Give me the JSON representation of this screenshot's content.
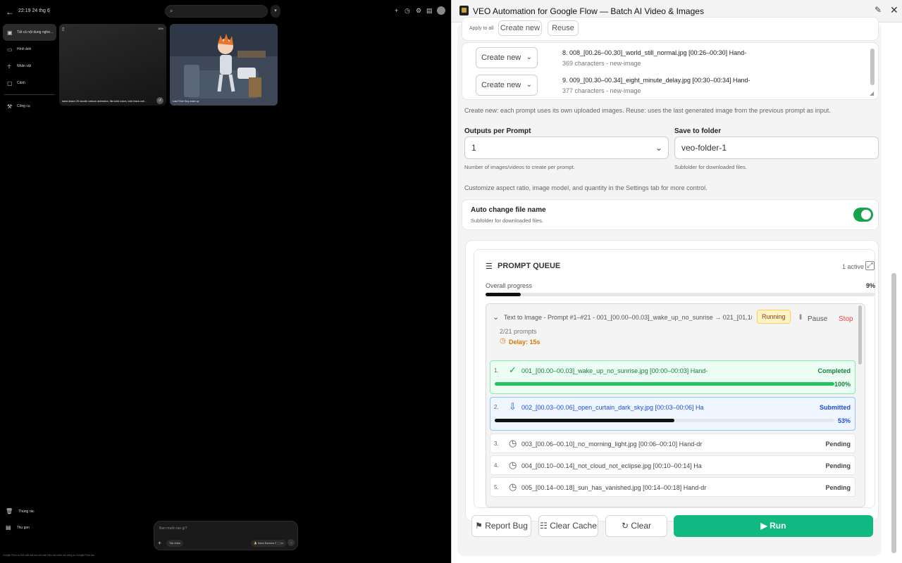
{
  "left": {
    "title": "22:19 24 thg 6",
    "sidebar": [
      {
        "icon": "image-icon",
        "label": "Tất cả nội dung nghe...",
        "active": true
      },
      {
        "icon": "photo-icon",
        "label": "Hình ảnh"
      },
      {
        "icon": "person-icon",
        "label": "Nhân vật"
      },
      {
        "icon": "scene-icon",
        "label": "Cảnh"
      },
      {
        "icon": "tools-icon",
        "label": "Công cụ"
      }
    ],
    "thumbnails": [
      {
        "caption": "hand drawn 2D doodle cartoon animation, flat solid colors, bold black outl...",
        "badge": "16%"
      },
      {
        "caption": "Last Time Guy wake up"
      }
    ],
    "bottom_items": [
      {
        "icon": "trash-icon",
        "label": "Thùng rác"
      },
      {
        "icon": "collapse-icon",
        "label": "Thu gọn"
      }
    ],
    "compose": {
      "placeholder": "Bạn muốn tạo gì?",
      "chip_left": "Tác nhân",
      "chip_right": "🍌 Nano Banana 2 ⬚ 1x"
    },
    "footer": "Google Flow có thể mắc sai sót nên bạn hãy xác minh nội dung do Google Flow tạo"
  },
  "header": {
    "title": "VEO Automation for Google Flow — Batch AI Video & Images"
  },
  "apply_all": {
    "label": "Apply to all",
    "create_new": "Create new",
    "reuse": "Reuse"
  },
  "prompt_items": [
    {
      "mode": "Create new",
      "line1": "8. 008_[00.26–00.30]_world_still_normal.jpg [00:26–00:30] Hand-",
      "line2": "369 characters - new-image"
    },
    {
      "mode": "Create new",
      "line1": "9. 009_[00.30–00.34]_eight_minute_delay.jpg [00:30–00:34] Hand-",
      "line2": "377 characters - new-image"
    }
  ],
  "mode_note": "Create new: each prompt uses its own uploaded images. Reuse: uses the last generated image from the previous prompt as input.",
  "outputs": {
    "label": "Outputs per Prompt",
    "value": "1",
    "help": "Number of images/videos to create per prompt."
  },
  "save_folder": {
    "label": "Save to folder",
    "value": "veo-folder-1",
    "help": "Subfolder for downloaded files."
  },
  "settings_note": "Customize aspect ratio, image model, and quantity in the Settings tab for more control.",
  "auto_rename": {
    "label": "Auto change file name",
    "help": "Subfolder for downloaded files.",
    "on": true
  },
  "queue": {
    "title": "PROMPT QUEUE",
    "active_label": "1 active",
    "overall_label": "Overall progress",
    "overall_percent": "9%",
    "overall_fraction": 0.09,
    "job": {
      "title": "Text to Image - Prompt #1–#21 - 001_[00.00–00.03]_wake_up_no_sunrise → 021_[01.18–01.21]_l...",
      "status": "Running",
      "pause": "Pause",
      "stop": "Stop",
      "count": "2/21 prompts",
      "delay": "Delay: 15s"
    },
    "items": [
      {
        "n": "1.",
        "icon": "check-circle-icon",
        "name": "001_[00.00–00.03]_wake_up_no_sunrise.jpg [00:00–00:03] Hand-",
        "status": "Completed",
        "percent": "100%",
        "fraction": 1.0
      },
      {
        "n": "2.",
        "icon": "download-icon",
        "name": "002_[00.03–00.06]_open_curtain_dark_sky.jpg [00:03–00:06] Ha",
        "status": "Submitted",
        "percent": "53%",
        "fraction": 0.53
      },
      {
        "n": "3.",
        "icon": "clock-icon",
        "name": "003_[00.06–00.10]_no_morning_light.jpg [00:06–00:10] Hand-dr",
        "status": "Pending"
      },
      {
        "n": "4.",
        "icon": "clock-icon",
        "name": "004_[00.10–00.14]_not_cloud_not_eclipse.jpg [00:10–00:14] Ha",
        "status": "Pending"
      },
      {
        "n": "5.",
        "icon": "clock-icon",
        "name": "005_[00.14–00.18]_sun_has_vanished.jpg [00:14–00:18] Hand-dr",
        "status": "Pending"
      }
    ]
  },
  "actions": {
    "report_bug": "Report Bug",
    "clear_cache": "Clear Cache",
    "clear": "Clear",
    "run": "Run"
  },
  "colors": {
    "accent": "#10b981",
    "completed": "#16a34a",
    "submitted": "#2563eb",
    "stop": "#ef4444",
    "running_badge": "#fef3c7",
    "delay": "#d97706"
  }
}
